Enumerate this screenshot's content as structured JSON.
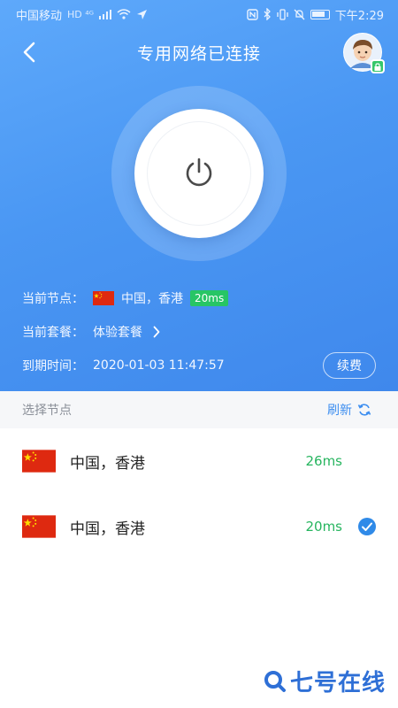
{
  "status_bar": {
    "carrier": "中国移动",
    "network_badges": "HD ⁴ᴳ",
    "time": "下午2:29"
  },
  "header": {
    "title": "专用网络已连接"
  },
  "connection": {
    "current_node_label": "当前节点：",
    "current_node": "中国，香港",
    "current_ping": "20ms",
    "plan_label": "当前套餐：",
    "plan": "体验套餐",
    "expiry_label": "到期时间：",
    "expiry": "2020-01-03 11:47:57",
    "renew_label": "续费"
  },
  "node_list": {
    "header_label": "选择节点",
    "refresh_label": "刷新",
    "items": [
      {
        "name": "中国，香港",
        "ping": "26ms",
        "selected": false
      },
      {
        "name": "中国，香港",
        "ping": "20ms",
        "selected": true
      }
    ]
  },
  "watermark": {
    "text": "七号在线"
  },
  "colors": {
    "accent": "#3d8ef0",
    "ping_green": "#27b55f",
    "hero_blue": "#4a97f3"
  }
}
